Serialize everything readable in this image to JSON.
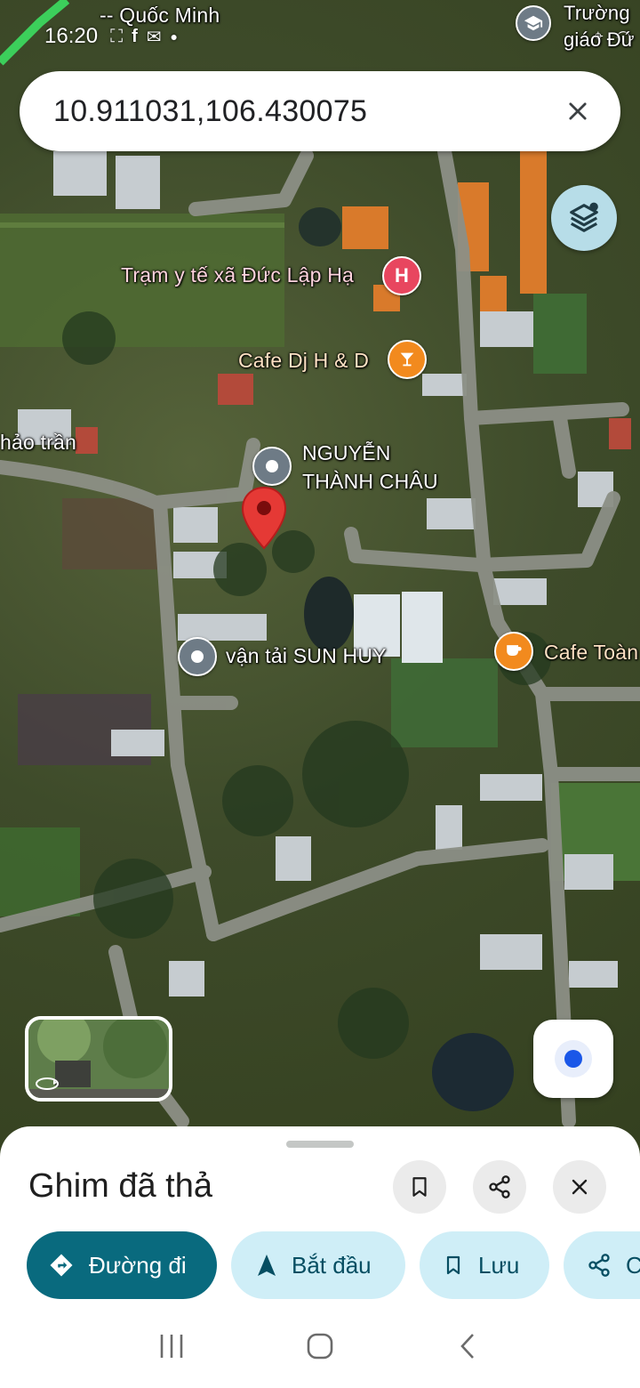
{
  "status_bar": {
    "time": "16:20",
    "overlay_left": "-- Quốc Minh",
    "overlay_right_1": "Trường",
    "overlay_right_2": "giáo Đứ"
  },
  "search": {
    "query": "10.911031,106.430075"
  },
  "map": {
    "labels": {
      "clinic": "Trạm y tế xã Đức Lập Hạ",
      "clinic_badge": "H",
      "cafe_dj": "Cafe Dj H & D",
      "person_line1": "NGUYỄN",
      "person_line2": "THÀNH CHÂU",
      "transport": "vận tải SUN HUY",
      "cafe_toan": "Cafe Toàn",
      "left_edge": "hảo trần"
    },
    "colors": {
      "dropped_pin": "#e53935",
      "clinic_pin": "#e8465f",
      "cafe_pin": "#f28a1e",
      "generic_pin": "#6e7b86"
    }
  },
  "sheet": {
    "title": "Ghim đã thả",
    "actions": {
      "directions": "Đường đi",
      "start": "Bắt đầu",
      "save": "Lưu",
      "share_partial": "C"
    },
    "accent": "#096a7e",
    "chip_bg": "#cfeef7"
  }
}
